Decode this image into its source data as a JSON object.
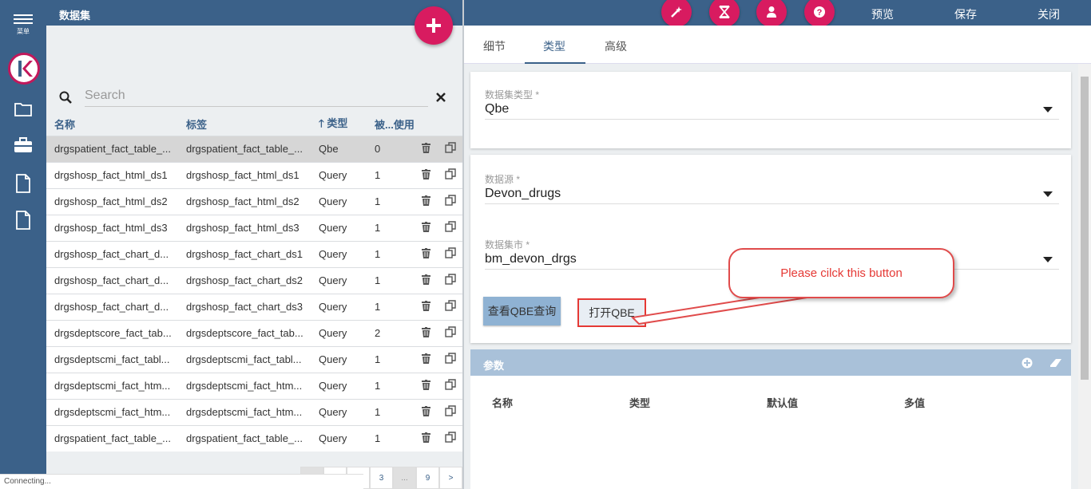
{
  "nav": {
    "menu_label": "菜单"
  },
  "list": {
    "title": "数据集",
    "search_placeholder": "Search",
    "columns": [
      "名称",
      "标签",
      "类型",
      "被...使用"
    ],
    "sort_arrow": "🡑",
    "rows": [
      {
        "name": "drgspatient_fact_table_...",
        "label": "drgspatient_fact_table_...",
        "type": "Qbe",
        "used": "0",
        "selected": true
      },
      {
        "name": "drgshosp_fact_html_ds1",
        "label": "drgshosp_fact_html_ds1",
        "type": "Query",
        "used": "1"
      },
      {
        "name": "drgshosp_fact_html_ds2",
        "label": "drgshosp_fact_html_ds2",
        "type": "Query",
        "used": "1"
      },
      {
        "name": "drgshosp_fact_html_ds3",
        "label": "drgshosp_fact_html_ds3",
        "type": "Query",
        "used": "1"
      },
      {
        "name": "drgshosp_fact_chart_d...",
        "label": "drgshosp_fact_chart_ds1",
        "type": "Query",
        "used": "1"
      },
      {
        "name": "drgshosp_fact_chart_d...",
        "label": "drgshosp_fact_chart_ds2",
        "type": "Query",
        "used": "1"
      },
      {
        "name": "drgshosp_fact_chart_d...",
        "label": "drgshosp_fact_chart_ds3",
        "type": "Query",
        "used": "1"
      },
      {
        "name": "drgsdeptscore_fact_tab...",
        "label": "drgsdeptscore_fact_tab...",
        "type": "Query",
        "used": "2"
      },
      {
        "name": "drgsdeptscmi_fact_tabl...",
        "label": "drgsdeptscmi_fact_tabl...",
        "type": "Query",
        "used": "1"
      },
      {
        "name": "drgsdeptscmi_fact_htm...",
        "label": "drgsdeptscmi_fact_htm...",
        "type": "Query",
        "used": "1"
      },
      {
        "name": "drgsdeptscmi_fact_htm...",
        "label": "drgsdeptscmi_fact_htm...",
        "type": "Query",
        "used": "1"
      },
      {
        "name": "drgspatient_fact_table_...",
        "label": "drgspatient_fact_table_...",
        "type": "Query",
        "used": "1"
      }
    ],
    "pager": [
      "",
      "",
      "",
      "3",
      "...",
      "9",
      ">"
    ],
    "status": "Connecting..."
  },
  "toolbar": {
    "preview": "预览",
    "save": "保存",
    "close": "关闭"
  },
  "tabs": [
    "细节",
    "类型",
    "高级"
  ],
  "form": {
    "dataset_type_label": "数据集类型 *",
    "dataset_type_value": "Qbe",
    "datasource_label": "数据源 *",
    "datasource_value": "Devon_drugs",
    "datamart_label": "数据集市 *",
    "datamart_value": "bm_devon_drgs",
    "view_qbe_button": "查看QBE查询",
    "open_qbe_button": "打开QBE"
  },
  "params": {
    "title": "参数",
    "columns": [
      "名称",
      "类型",
      "默认值",
      "多值"
    ]
  },
  "annotation": {
    "text": "Please cilck this button"
  },
  "colors": {
    "nav": "#3b6189",
    "accent": "#d81b60",
    "callout": "#e53935"
  }
}
